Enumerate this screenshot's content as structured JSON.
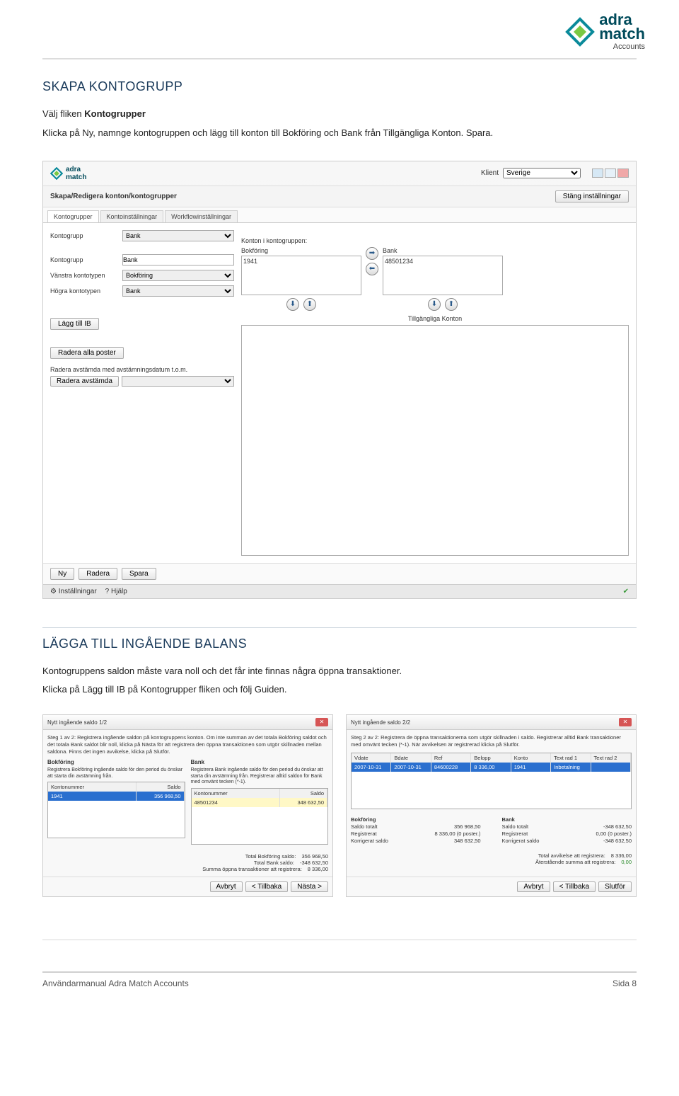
{
  "logo": {
    "brand_top": "adra",
    "brand_bot": "match",
    "sub": "Accounts"
  },
  "section1": {
    "title": "SKAPA KONTOGRUPP",
    "p1_a": "Välj fliken ",
    "p1_b": "Kontogrupper",
    "p2": "Klicka på Ny, namnge kontogruppen och lägg till konton till Bokföring och Bank från Tillgängliga Konton. Spara."
  },
  "app": {
    "klient_label": "Klient",
    "klient_value": "Sverige",
    "bar_title": "Skapa/Redigera konton/kontogrupper",
    "btn_close_settings": "Stäng inställningar",
    "tabs": [
      "Kontogrupper",
      "Kontoinställningar",
      "Workflowinställningar"
    ],
    "left": {
      "kontogrupp_label": "Kontogrupp",
      "kontogrupp_sel": "Bank",
      "kontogrupp_input_label": "Kontogrupp",
      "kontogrupp_input": "Bank",
      "vanstra_label": "Vänstra kontotypen",
      "vanstra_val": "Bokföring",
      "hogra_label": "Högra kontotypen",
      "hogra_val": "Bank",
      "lagg_ib": "Lägg till IB",
      "radera_alla": "Radera alla poster",
      "radera_avst_label": "Radera avstämda med avstämningsdatum t.o.m.",
      "radera_avst": "Radera avstämda"
    },
    "right": {
      "konton_i": "Konton i kontogruppen:",
      "col1": "Bokföring",
      "col2": "Bank",
      "val1": "1941",
      "val2": "48501234",
      "tillg": "Tillgängliga Konton"
    },
    "bottom": [
      "Ny",
      "Radera",
      "Spara"
    ],
    "status": {
      "inst": "Inställningar",
      "hjalp": "Hjälp"
    }
  },
  "section2": {
    "title": "LÄGGA TILL INGÅENDE BALANS",
    "p1": "Kontogruppens saldon måste vara noll och det får inte finnas några öppna transaktioner.",
    "p2": "Klicka på Lägg till IB på Kontogrupper fliken och följ Guiden."
  },
  "dlg1": {
    "title": "Nytt ingående saldo 1/2",
    "step": "Steg 1 av 2: Registrera ingående saldon på kontogruppens konton. Om inte summan av det totala Bokföring saldot och det totala Bank saldot blir noll, klicka på Nästa för att registrera den öppna transaktionen som utgör skillnaden mellan saldona. Finns det ingen avvikelse, klicka på Slutför.",
    "bokforing": "Bokföring",
    "bank": "Bank",
    "bokf_note": "Registrera Bokföring ingående saldo för den period du önskar att starta din avstämning från.",
    "bank_note": "Registrera Bank ingående saldo för den period du önskar att starta din avstämning från. Registrerar alltid saldon för Bank med omvänt tecken (*-1).",
    "hdr_kontonummer": "Kontonummer",
    "hdr_saldo": "Saldo",
    "row1_k": "1941",
    "row1_s": "356 968,50",
    "row2_k": "48501234",
    "row2_s": "348 632,50",
    "tot_bokf_l": "Total Bokföring saldo:",
    "tot_bokf_v": "356 968,50",
    "tot_bank_l": "Total Bank saldo:",
    "tot_bank_v": "-348 632,50",
    "sum_l": "Summa öppna transaktioner att registrera:",
    "sum_v": "8 336,00",
    "btns": [
      "Avbryt",
      "< Tillbaka",
      "Nästa >"
    ]
  },
  "dlg2": {
    "title": "Nytt ingående saldo 2/2",
    "step": "Steg 2 av 2: Registrera de öppna transaktionerna som utgör skillnaden i saldo. Registrerar alltid Bank transaktioner med omvänt tecken (*-1). När avvikelsen är registrerad klicka på Slutför.",
    "hdr": [
      "Vdate",
      "Bdate",
      "Ref",
      "Belopp",
      "Konto",
      "Text rad 1",
      "Text rad 2"
    ],
    "row": [
      "2007-10-31",
      "2007-10-31",
      "84600228",
      "8 336,00",
      "1941",
      "Inbetalning",
      ""
    ],
    "bokf": "Bokföring",
    "bank": "Bank",
    "saldo_totalt": "Saldo totalt",
    "registrerat": "Registrerat",
    "korrigerat": "Korrigerat saldo",
    "bokf_saldo": "356 968,50",
    "bokf_reg": "8 336,00",
    "bokf_reg_p": "(0 poster.)",
    "bokf_korr": "348 632,50",
    "bank_saldo": "-348 632,50",
    "bank_reg": "0,00",
    "bank_reg_p": "(0 poster.)",
    "bank_korr": "-348 632,50",
    "tot_avv_l": "Total avvikelse att registrera:",
    "tot_avv_v": "8 336,00",
    "aterst_l": "Återstående summa att registrera:",
    "aterst_v": "0,00",
    "btns": [
      "Avbryt",
      "< Tillbaka",
      "Slutför"
    ]
  },
  "footer": {
    "left": "Användarmanual Adra Match Accounts",
    "right": "Sida 8"
  }
}
